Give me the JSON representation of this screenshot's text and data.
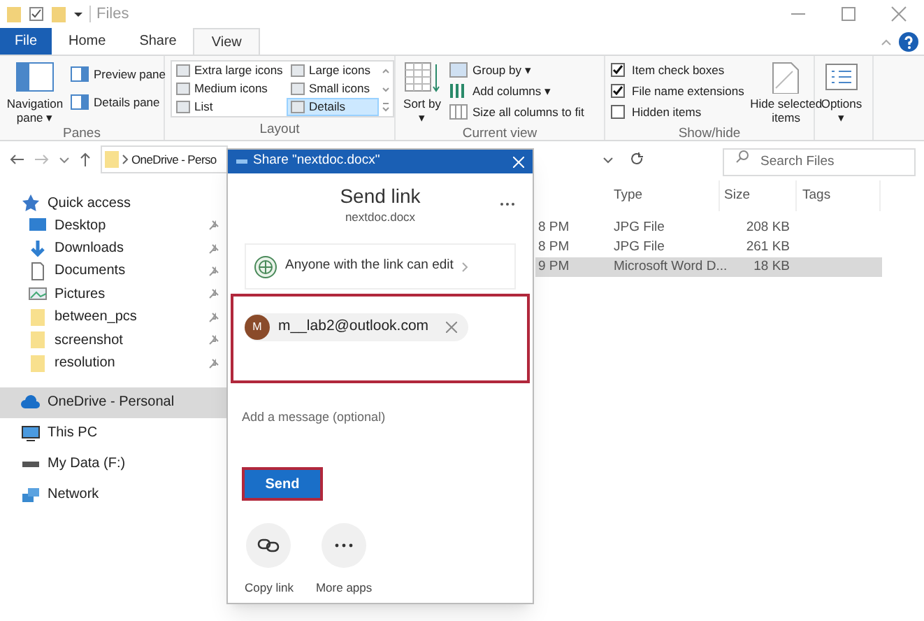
{
  "window": {
    "title": "Files"
  },
  "ribbon_tabs": [
    {
      "label": "File",
      "kind": "file",
      "selected": false
    },
    {
      "label": "Home",
      "kind": "tab",
      "selected": false
    },
    {
      "label": "Share",
      "kind": "tab",
      "selected": false
    },
    {
      "label": "View",
      "kind": "tab",
      "selected": true
    }
  ],
  "ribbon_groups": [
    {
      "label": "Panes",
      "items": [
        {
          "kind": "large",
          "label": "Navigation pane ▾"
        },
        {
          "kind": "small",
          "label": "Preview pane"
        },
        {
          "kind": "small",
          "label": "Details pane"
        }
      ]
    },
    {
      "label": "Layout",
      "items": [
        {
          "kind": "view",
          "label": "Extra large icons",
          "selected": false
        },
        {
          "kind": "view",
          "label": "Large icons",
          "selected": false
        },
        {
          "kind": "view",
          "label": "Medium icons",
          "selected": false
        },
        {
          "kind": "view",
          "label": "Small icons",
          "selected": false
        },
        {
          "kind": "view",
          "label": "List",
          "selected": false
        },
        {
          "kind": "view",
          "label": "Details",
          "selected": true
        }
      ]
    },
    {
      "label": "Current view",
      "items": [
        {
          "kind": "large",
          "label": "Sort by ▾"
        },
        {
          "kind": "small",
          "label": "Group by ▾"
        },
        {
          "kind": "small",
          "label": "Add columns ▾"
        },
        {
          "kind": "small",
          "label": "Size all columns to fit"
        }
      ]
    },
    {
      "label": "Show/hide",
      "items": [
        {
          "kind": "check",
          "label": "Item check boxes",
          "checked": true
        },
        {
          "kind": "check",
          "label": "File name extensions",
          "checked": true
        },
        {
          "kind": "check",
          "label": "Hidden items",
          "checked": false
        },
        {
          "kind": "large",
          "label": "Hide selected items"
        }
      ]
    },
    {
      "items": [
        {
          "kind": "large",
          "label": "Options ▾"
        }
      ]
    }
  ],
  "address": {
    "path": "OneDrive - Perso",
    "search_placeholder": "Search Files"
  },
  "navigation": [
    {
      "label": "Quick access",
      "kind": "star",
      "selected": false,
      "children": [
        {
          "label": "Desktop",
          "kind": "desktop",
          "pinned": true
        },
        {
          "label": "Downloads",
          "kind": "download",
          "pinned": true
        },
        {
          "label": "Documents",
          "kind": "document",
          "pinned": true
        },
        {
          "label": "Pictures",
          "kind": "pictures",
          "pinned": true
        },
        {
          "label": "between_pcs",
          "kind": "folder",
          "pinned": true
        },
        {
          "label": "screenshot",
          "kind": "folder",
          "pinned": true
        },
        {
          "label": "resolution",
          "kind": "folder",
          "pinned": true
        }
      ]
    },
    {
      "label": "OneDrive - Personal",
      "kind": "cloud",
      "selected": true
    },
    {
      "label": "This PC",
      "kind": "pc",
      "selected": false
    },
    {
      "label": "My Data (F:)",
      "kind": "drive",
      "selected": false
    },
    {
      "label": "Network",
      "kind": "network",
      "selected": false
    }
  ],
  "file_list": {
    "columns": [
      "Type",
      "Size",
      "Tags"
    ],
    "rows": [
      {
        "modified": "8 PM",
        "type": "JPG File",
        "size": "208 KB",
        "selected": false
      },
      {
        "modified": "8 PM",
        "type": "JPG File",
        "size": "261 KB",
        "selected": false
      },
      {
        "modified": "9 PM",
        "type": "Microsoft Word D...",
        "size": "18 KB",
        "selected": true
      }
    ]
  },
  "share_dialog": {
    "title": "Share \"nextdoc.docx\"",
    "heading": "Send link",
    "file_name": "nextdoc.docx",
    "link_setting": "Anyone with the link can edit",
    "recipient": {
      "initial": "M",
      "email": "m__lab2@outlook.com",
      "highlighted": true
    },
    "message_placeholder": "Add a message (optional)",
    "send": {
      "label": "Send",
      "highlighted": true
    },
    "actions": [
      {
        "kind": "copy",
        "label": "Copy link"
      },
      {
        "kind": "more",
        "label": "More apps"
      }
    ]
  }
}
